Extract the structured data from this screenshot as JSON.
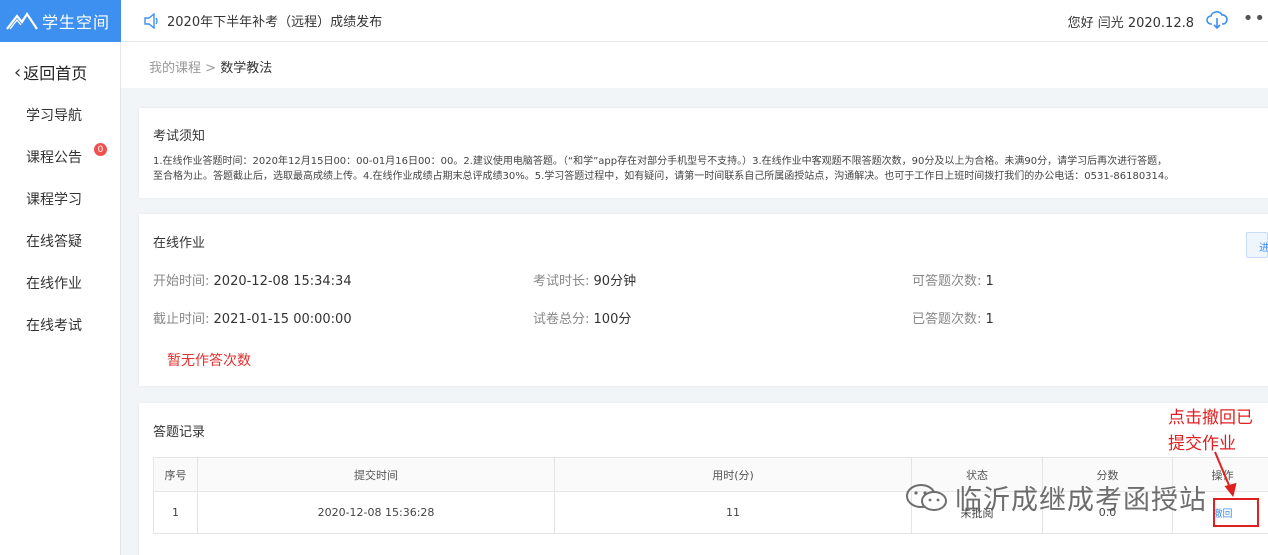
{
  "topbar": {
    "logo_text": "学生空间",
    "announcement": "2020年下半年补考（远程）成绩发布",
    "greeting": "您好 闫光 2020.12.8",
    "more": "••"
  },
  "sidebar": {
    "back": "返回首页",
    "items": [
      {
        "label": "学习导航"
      },
      {
        "label": "课程公告",
        "badge": "0"
      },
      {
        "label": "课程学习"
      },
      {
        "label": "在线答疑"
      },
      {
        "label": "在线作业"
      },
      {
        "label": "在线考试"
      }
    ]
  },
  "breadcrumb": {
    "parent": "我的课程",
    "sep": ">",
    "current": "数学教法"
  },
  "notice": {
    "title": "考试须知",
    "line1": "1.在线作业答题时间：2020年12月15日00：00-01月16日00：00。2.建议使用电脑答题。（“和学”app存在对部分手机型号不支持。）3.在线作业中客观题不限答题次数，90分及以上为合格。未满90分，请学习后再次进行答题，",
    "line2": "至合格为止。答题截止后，选取最高成绩上传。4.在线作业成绩占期末总评成绩30%。5.学习答题过程中，如有疑问，请第一时间联系自己所属函授站点，沟通解决。也可于工作日上班时间拨打我们的办公电话：0531-86180314。"
  },
  "homework": {
    "title": "在线作业",
    "start_label": "开始时间:",
    "start_value": "2020-12-08 15:34:34",
    "end_label": "截止时间:",
    "end_value": "2021-01-15 00:00:00",
    "duration_label": "考试时长:",
    "duration_value": "90分钟",
    "total_label": "试卷总分:",
    "total_value": "100分",
    "allowed_label": "可答题次数:",
    "allowed_value": "1",
    "answered_label": "已答题次数:",
    "answered_value": "1",
    "no_attempt": "暂无作答次数",
    "side_button": "进"
  },
  "records": {
    "title": "答题记录",
    "headers": [
      "序号",
      "提交时间",
      "用时(分)",
      "状态",
      "分数",
      "操作"
    ],
    "rows": [
      {
        "index": "1",
        "submit_time": "2020-12-08 15:36:28",
        "duration": "11",
        "status": "未批阅",
        "score": "0.0",
        "action": "撤回"
      }
    ]
  },
  "annotation": {
    "line1": "点击撤回已",
    "line2": "提交作业",
    "color": "#e02020"
  },
  "watermark": {
    "text": "临沂成继成考函授站"
  },
  "colors": {
    "brand": "#3d8ff0",
    "danger": "#e03030"
  }
}
